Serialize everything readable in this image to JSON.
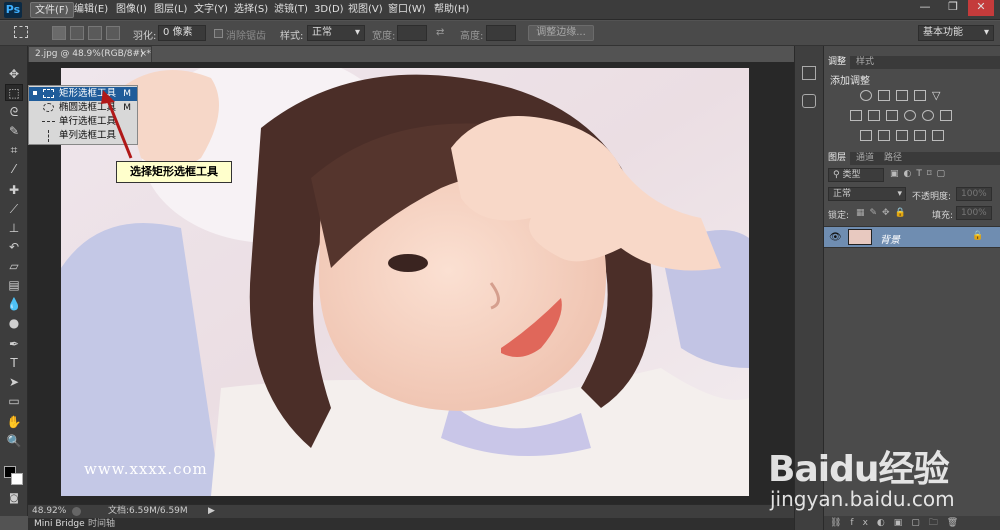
{
  "app": {
    "logo": "Ps"
  },
  "menu": [
    "文件(F)",
    "编辑(E)",
    "图像(I)",
    "图层(L)",
    "文字(Y)",
    "选择(S)",
    "滤镜(T)",
    "3D(D)",
    "视图(V)",
    "窗口(W)",
    "帮助(H)"
  ],
  "options": {
    "feather_label": "羽化:",
    "feather_value": "0 像素",
    "antialias_label": "消除锯齿",
    "style_label": "样式:",
    "style_value": "正常",
    "width_label": "宽度:",
    "height_label": "高度:",
    "refine_button": "调整边缘...",
    "workspace": "基本功能"
  },
  "document": {
    "tab_title": "2.jpg @ 48.9%(RGB/8#) *"
  },
  "flyout": {
    "items": [
      {
        "label": "矩形选框工具",
        "key": "M"
      },
      {
        "label": "椭圆选框工具",
        "key": "M"
      },
      {
        "label": "单行选框工具",
        "key": ""
      },
      {
        "label": "单列选框工具",
        "key": ""
      }
    ]
  },
  "callout": "选择矩形选框工具",
  "image_watermark": "www.xxxx.com",
  "status": {
    "zoom": "48.92%",
    "doc_info": "文档:6.59M/6.59M"
  },
  "bottom_tabs": [
    "Mini Bridge",
    "时间轴"
  ],
  "adjust_panel": {
    "tabs": [
      "调整",
      "样式"
    ],
    "title": "添加调整"
  },
  "layers_panel": {
    "tabs": [
      "图层",
      "通道",
      "路径"
    ],
    "kind_label": "类型",
    "blend_mode": "正常",
    "opacity_label": "不透明度:",
    "opacity_value": "100%",
    "lock_label": "锁定:",
    "fill_label": "填充:",
    "fill_value": "100%",
    "layer_name": "背景"
  },
  "watermark": {
    "brand": "Baidu经验",
    "url": "jingyan.baidu.com"
  },
  "colors": {
    "highlight": "#1f5c9a",
    "layer_selected": "#6f8db1",
    "callout_bg": "#ffffcc"
  }
}
